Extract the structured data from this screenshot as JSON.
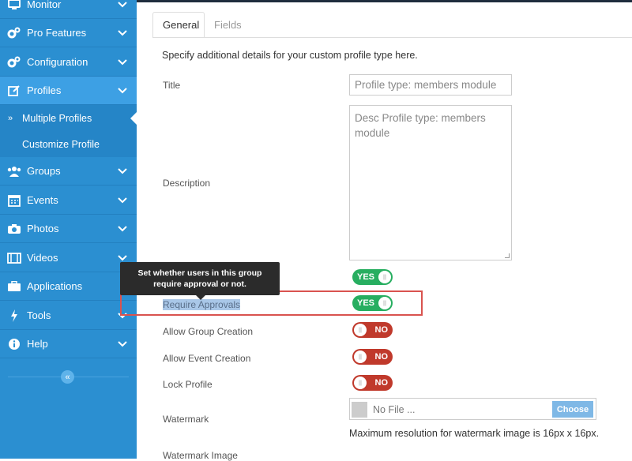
{
  "sidebar": {
    "items": [
      {
        "label": "Monitor",
        "icon": "monitor-icon"
      },
      {
        "label": "Pro Features",
        "icon": "gears-icon"
      },
      {
        "label": "Configuration",
        "icon": "gears-icon"
      },
      {
        "label": "Profiles",
        "icon": "edit-icon"
      },
      {
        "label": "Groups",
        "icon": "users-icon"
      },
      {
        "label": "Events",
        "icon": "calendar-icon"
      },
      {
        "label": "Photos",
        "icon": "camera-icon"
      },
      {
        "label": "Videos",
        "icon": "film-icon"
      },
      {
        "label": "Applications",
        "icon": "briefcase-icon"
      },
      {
        "label": "Tools",
        "icon": "bolt-icon"
      },
      {
        "label": "Help",
        "icon": "info-icon"
      }
    ],
    "submenu": [
      {
        "label": "Multiple Profiles",
        "marker": "»"
      },
      {
        "label": "Customize Profile",
        "marker": ""
      }
    ],
    "collapse_glyph": "«"
  },
  "tabs": [
    {
      "label": "General"
    },
    {
      "label": "Fields"
    }
  ],
  "intro": "Specify additional details for your custom profile type here.",
  "form": {
    "title_label": "Title",
    "title_value": "Profile type: members module",
    "description_label": "Description",
    "description_value": "Desc Profile type: members module",
    "first_toggle": "YES",
    "require_approvals_label": "Require Approvals",
    "require_approvals_toggle": "YES",
    "allow_group_label": "Allow Group Creation",
    "allow_group_toggle": "NO",
    "allow_event_label": "Allow Event Creation",
    "allow_event_toggle": "NO",
    "lock_profile_label": "Lock Profile",
    "lock_profile_toggle": "NO",
    "watermark_label": "Watermark",
    "file_placeholder": "No File ...",
    "choose_label": "Choose",
    "watermark_note": "Maximum resolution for watermark image is 16px x 16px.",
    "watermark_image_label": "Watermark Image"
  },
  "tooltip": {
    "line1": "Set whether users in this group",
    "line2": "require approval or not."
  },
  "colors": {
    "sidebar": "#2b8fd1",
    "yes": "#27ae60",
    "no": "#c0392b",
    "highlight": "#d9534f"
  }
}
